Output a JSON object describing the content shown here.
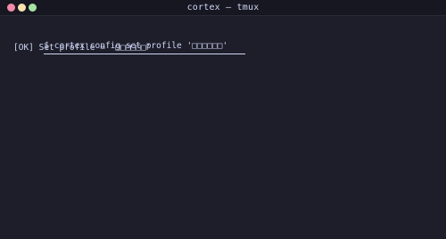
{
  "window": {
    "title": "cortex — tmux",
    "controls": {
      "close_color": "#f38ba8",
      "minimize_color": "#f9e2af",
      "maximize_color": "#a6e3a1"
    }
  },
  "terminal": {
    "background": "#1e1e2a",
    "foreground": "#cdd6f4",
    "lines": [
      {
        "type": "command",
        "text": "$ cortex config set profile '□□□□□□'"
      },
      {
        "type": "output",
        "text": "[OK] Set profile = '□□□□□□'"
      }
    ]
  }
}
